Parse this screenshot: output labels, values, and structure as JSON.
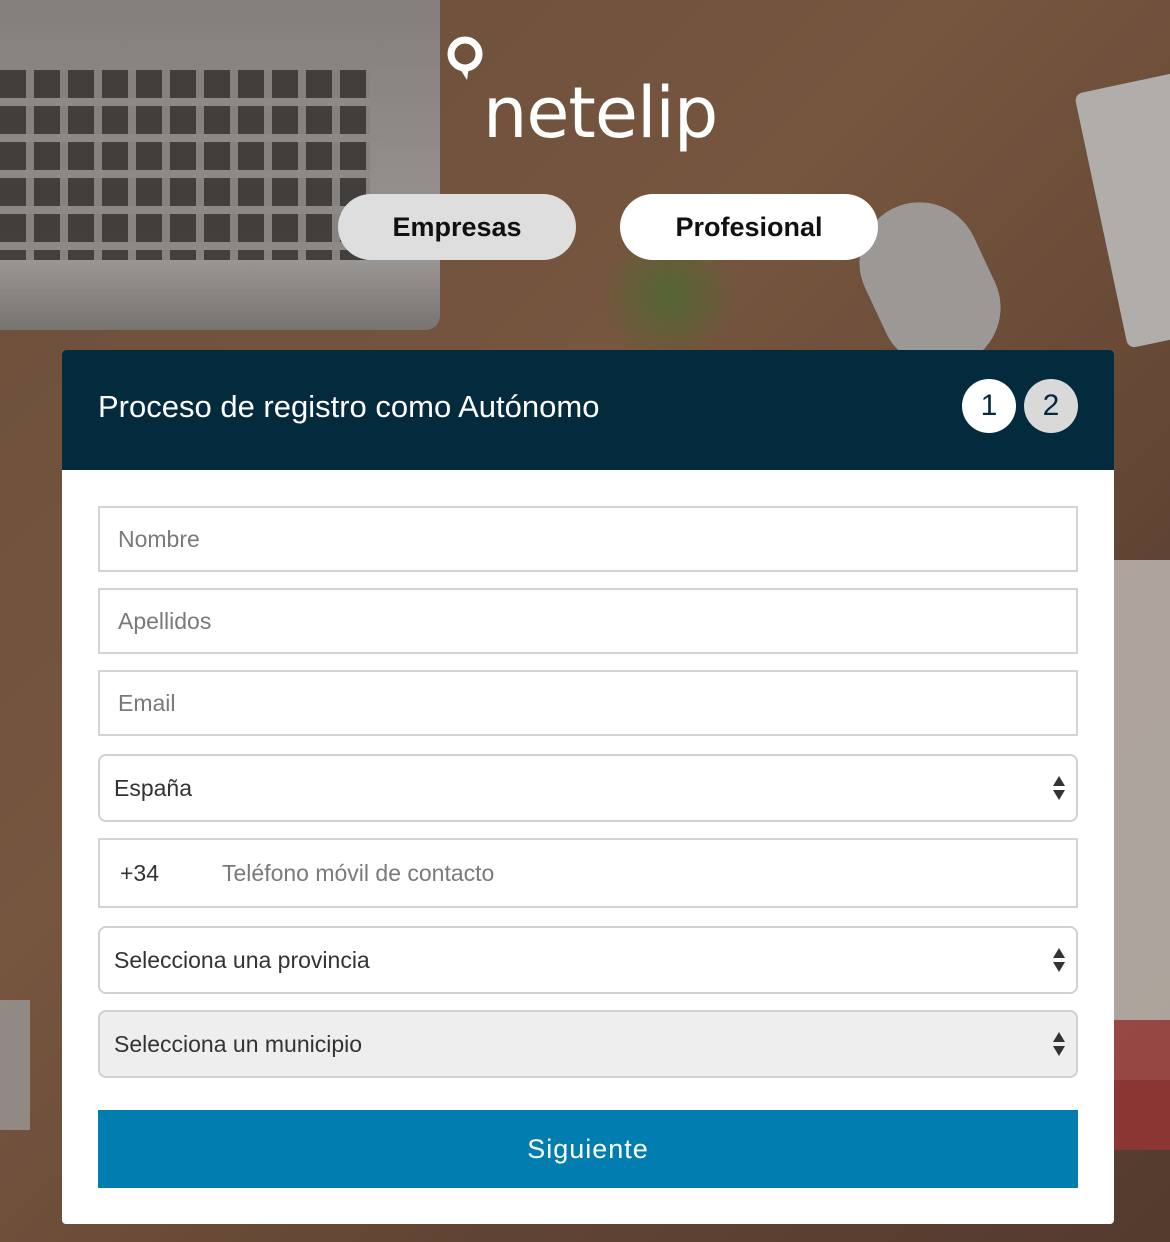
{
  "brand": {
    "logo_text": "netelip"
  },
  "tabs": [
    {
      "label": "Empresas",
      "active": false
    },
    {
      "label": "Profesional",
      "active": true
    }
  ],
  "card": {
    "title": "Proceso de registro como Autónomo",
    "steps": [
      "1",
      "2"
    ],
    "current_step": 1
  },
  "form": {
    "nombre_placeholder": "Nombre",
    "apellidos_placeholder": "Apellidos",
    "email_placeholder": "Email",
    "country_value": "España",
    "phone_prefix": "+34",
    "phone_placeholder": "Teléfono móvil de contacto",
    "province_value": "Selecciona una provincia",
    "municipality_value": "Selecciona un municipio",
    "submit_label": "Siguiente"
  },
  "colors": {
    "header_bg": "#032a3d",
    "accent": "#027db0",
    "tab_inactive": "#dedede",
    "tab_active": "#ffffff"
  },
  "icons": [
    "location-pin-icon",
    "select-arrows-icon"
  ]
}
